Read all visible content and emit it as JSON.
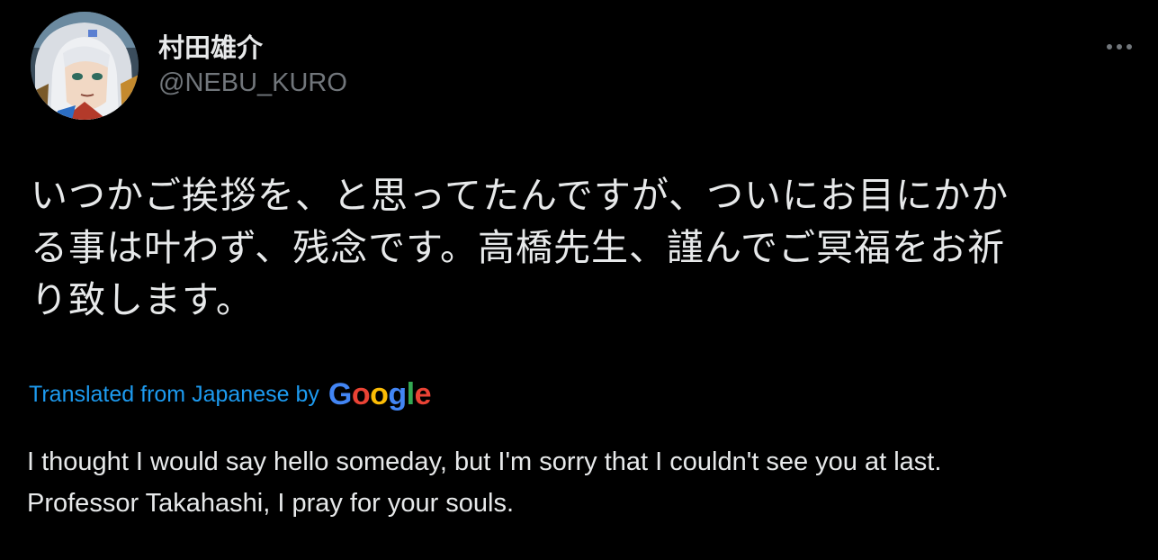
{
  "author": {
    "display_name": "村田雄介",
    "handle": "@NEBU_KURO",
    "avatar_icon": "user-avatar"
  },
  "more_icon": "more-dots-icon",
  "tweet": {
    "text": "いつかご挨拶を、と思ってたんですが、ついにお目にかか\nる事は叶わず、残念です。高橋先生、謹んでご冥福をお祈\nり致します。"
  },
  "translation": {
    "label": "Translated from Japanese by",
    "provider": {
      "letters": [
        "G",
        "o",
        "o",
        "g",
        "l",
        "e"
      ],
      "colors": [
        "#4285F4",
        "#EA4335",
        "#FBBC05",
        "#4285F4",
        "#34A853",
        "#EA4335"
      ]
    },
    "text": "I thought I would say hello someday, but I'm sorry that I couldn't see you at last.\nProfessor Takahashi, I pray for your souls."
  },
  "colors": {
    "background": "#000000",
    "text_primary": "#e7e9ea",
    "text_secondary": "#71767b",
    "link": "#1d9bf0"
  }
}
